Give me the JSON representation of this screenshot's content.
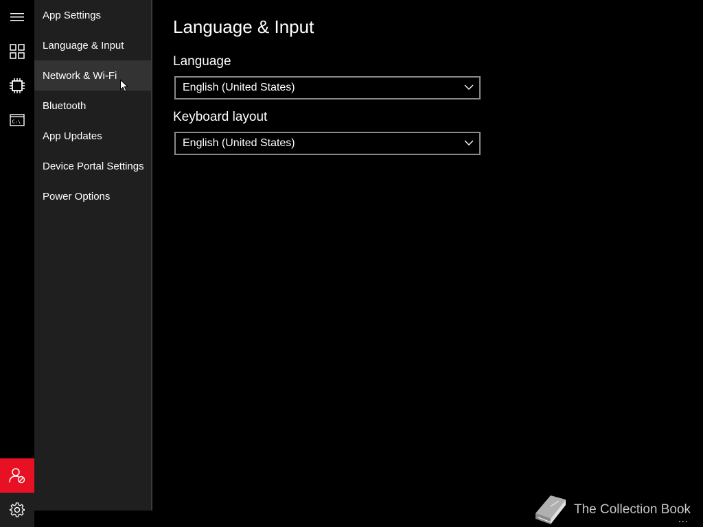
{
  "rail": {
    "icons": [
      "hamburger-icon",
      "dashboard-icon",
      "processor-icon",
      "command-prompt-icon",
      "account-icon",
      "gear-icon"
    ],
    "accent_color": "#e81123"
  },
  "nav": {
    "items": [
      {
        "label": "App Settings"
      },
      {
        "label": "Language & Input"
      },
      {
        "label": "Network & Wi-Fi"
      },
      {
        "label": "Bluetooth"
      },
      {
        "label": "App Updates"
      },
      {
        "label": "Device Portal Settings"
      },
      {
        "label": "Power Options"
      }
    ],
    "hovered": "Network & Wi-Fi"
  },
  "main": {
    "title": "Language & Input",
    "language": {
      "label": "Language",
      "value": "English (United States)"
    },
    "keyboard": {
      "label": "Keyboard layout",
      "value": "English (United States)"
    }
  },
  "watermark": {
    "text": "The Collection Book"
  },
  "more": "..."
}
